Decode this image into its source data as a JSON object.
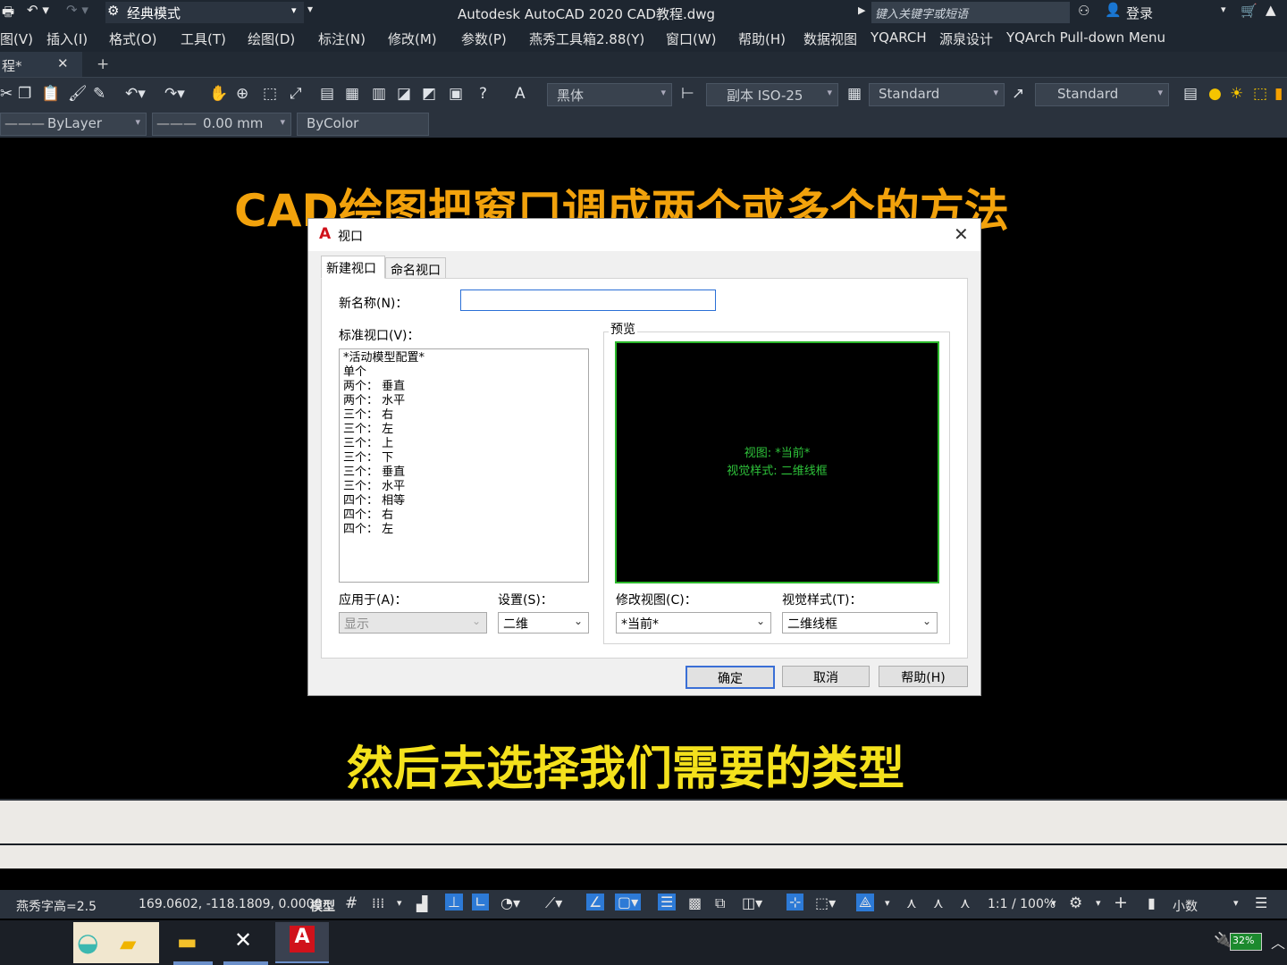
{
  "titlebar": {
    "workspace": "经典模式",
    "title": "Autodesk AutoCAD 2020    CAD教程.dwg",
    "search_placeholder": "键入关键字或短语",
    "login": "登录"
  },
  "menu": [
    "图(V)",
    "插入(I)",
    "格式(O)",
    "工具(T)",
    "绘图(D)",
    "标注(N)",
    "修改(M)",
    "参数(P)",
    "燕秀工具箱2.88(Y)",
    "窗口(W)",
    "帮助(H)",
    "数据视图",
    "YQARCH",
    "源泉设计",
    "YQArch Pull-down Menu"
  ],
  "tabs": {
    "doc": "程*",
    "close": "✕",
    "add": "+"
  },
  "toolbar": {
    "text_style": "黑体",
    "dim_style": "副本 ISO-25",
    "table_style": "Standard",
    "mleader_style": "Standard"
  },
  "properties": {
    "linetype": "ByLayer",
    "lineweight": "0.00 mm",
    "color": "ByColor"
  },
  "captions": {
    "top": "CAD绘图把窗口调成两个或多个的方法",
    "bottom": "然后去选择我们需要的类型"
  },
  "dialog": {
    "title": "视口",
    "tab_new": "新建视口",
    "tab_named": "命名视口",
    "new_name_label": "新名称(N)：",
    "new_name_value": "",
    "standard_label": "标准视口(V)：",
    "standard_items": [
      "*活动模型配置*",
      "单个",
      "两个： 垂直",
      "两个： 水平",
      "三个： 右",
      "三个： 左",
      "三个： 上",
      "三个： 下",
      "三个： 垂直",
      "三个： 水平",
      "四个： 相等",
      "四个： 右",
      "四个： 左"
    ],
    "preview_label": "预览",
    "preview_line1": "视图: *当前*",
    "preview_line2": "视觉样式: 二维线框",
    "apply_label": "应用于(A)：",
    "apply_value": "显示",
    "setup_label": "设置(S)：",
    "setup_value": "二维",
    "change_view_label": "修改视图(C)：",
    "change_view_value": "*当前*",
    "visual_style_label": "视觉样式(T)：",
    "visual_style_value": "二维线框",
    "ok": "确定",
    "cancel": "取消",
    "help": "帮助(H)"
  },
  "status": {
    "text_height": "燕秀字高=2.5",
    "coords": "169.0602, -118.1809, 0.0000",
    "model": "模型",
    "scale": "1:1 / 100%",
    "units": "小数"
  },
  "taskbar": {
    "battery": "32%"
  }
}
